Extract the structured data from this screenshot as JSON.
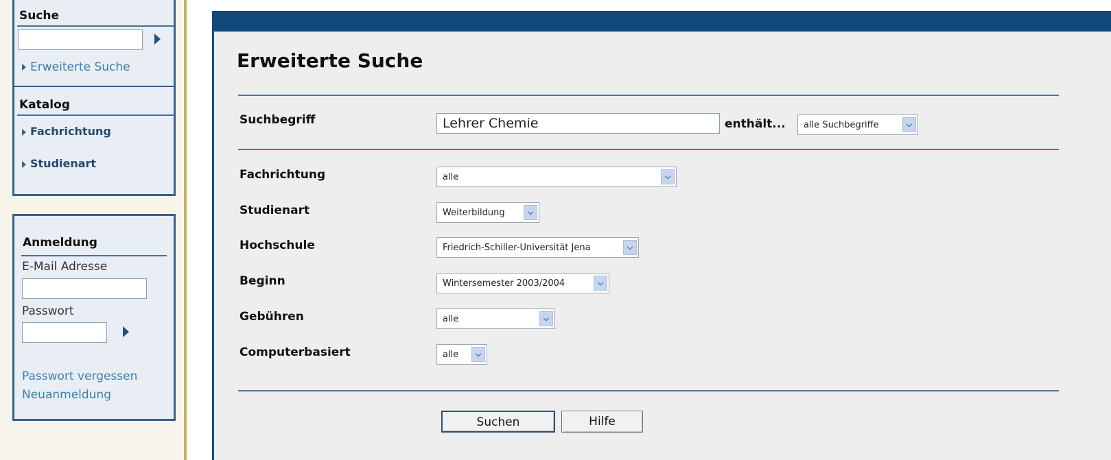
{
  "sidebar": {
    "search": {
      "title": "Suche",
      "input_value": "",
      "advanced_link": "Erweiterte Suche"
    },
    "catalog": {
      "title": "Katalog",
      "items": [
        "Fachrichtung",
        "Studienart"
      ]
    },
    "login": {
      "title": "Anmeldung",
      "email_label": "E-Mail Adresse",
      "email_value": "",
      "password_label": "Passwort",
      "password_value": "",
      "forgot_link": "Passwort vergessen",
      "register_link": "Neuanmeldung"
    }
  },
  "main": {
    "title": "Erweiterte Suche",
    "search_term": {
      "label": "Suchbegriff",
      "value": "Lehrer Chemie",
      "contains_label": "enthält...",
      "mode_value": "alle Suchbegriffe"
    },
    "filters": [
      {
        "label": "Fachrichtung",
        "value": "alle"
      },
      {
        "label": "Studienart",
        "value": "Weiterbildung"
      },
      {
        "label": "Hochschule",
        "value": "Friedrich-Schiller-Universität Jena"
      },
      {
        "label": "Beginn",
        "value": "Wintersemester 2003/2004"
      },
      {
        "label": "Gebühren",
        "value": "alle"
      },
      {
        "label": "Computerbasiert",
        "value": "alle"
      }
    ],
    "buttons": {
      "search": "Suchen",
      "help": "Hilfe"
    }
  },
  "colors": {
    "header_bar": "#104a7c",
    "link": "#3b7fae",
    "border": "#3a5f8a"
  }
}
